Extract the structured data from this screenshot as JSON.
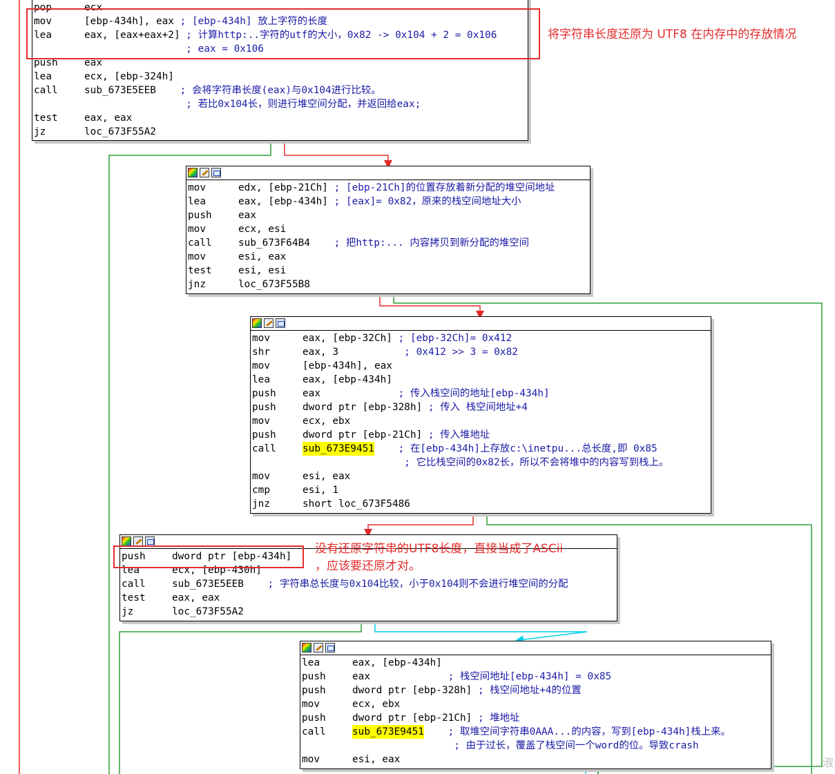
{
  "blocks": [
    {
      "has_header": false,
      "lines": [
        {
          "mn": "pop",
          "op": "ecx",
          "cm": ""
        },
        {
          "mn": "mov",
          "op": "[ebp-434h], eax",
          "cm": " ; [ebp-434h] 放上字符的长度"
        },
        {
          "mn": "lea",
          "op": "eax, [eax+eax+2]",
          "cm": " ; 计算http:..字符的utf的大小，0x82 -> 0x104 + 2 = 0x106"
        },
        {
          "mn": "",
          "op": "",
          "cm": "                 ; eax = 0x106"
        },
        {
          "mn": "push",
          "op": "eax",
          "cm": ""
        },
        {
          "mn": "lea",
          "op": "ecx, [ebp-324h]",
          "cm": ""
        },
        {
          "mn": "call",
          "op": "sub_673E5EEB",
          "cm": "    ; 会将字符串长度(eax)与0x104进行比较。"
        },
        {
          "mn": "",
          "op": "",
          "cm": "                 ; 若比0x104长，则进行堆空间分配，并返回给eax;"
        },
        {
          "mn": "test",
          "op": "eax, eax",
          "cm": ""
        },
        {
          "mn": "jz",
          "op": "loc_673F55A2",
          "cm": ""
        }
      ]
    },
    {
      "has_header": true,
      "lines": [
        {
          "mn": "mov",
          "op": "edx, [ebp-21Ch]",
          "cm": " ; [ebp-21Ch]的位置存放着新分配的堆空间地址"
        },
        {
          "mn": "lea",
          "op": "eax, [ebp-434h]",
          "cm": " ; [eax]= 0x82，原来的栈空间地址大小"
        },
        {
          "mn": "push",
          "op": "eax",
          "cm": ""
        },
        {
          "mn": "mov",
          "op": "ecx, esi",
          "cm": ""
        },
        {
          "mn": "call",
          "op": "sub_673F64B4",
          "cm": "    ; 把http:... 内容拷贝到新分配的堆空间"
        },
        {
          "mn": "mov",
          "op": "esi, eax",
          "cm": ""
        },
        {
          "mn": "test",
          "op": "esi, esi",
          "cm": ""
        },
        {
          "mn": "jnz",
          "op": "loc_673F55B8",
          "cm": ""
        }
      ]
    },
    {
      "has_header": true,
      "lines": [
        {
          "mn": "mov",
          "op": "eax, [ebp-32Ch]",
          "cm": " ; [ebp-32Ch]= 0x412"
        },
        {
          "mn": "shr",
          "op": "eax, 3",
          "cm": "           ; 0x412 >> 3 = 0x82"
        },
        {
          "mn": "mov",
          "op": "[ebp-434h], eax",
          "cm": ""
        },
        {
          "mn": "lea",
          "op": "eax, [ebp-434h]",
          "cm": ""
        },
        {
          "mn": "push",
          "op": "eax",
          "cm": "             ; 传入栈空间的地址[ebp-434h]"
        },
        {
          "mn": "push",
          "op": "dword ptr [ebp-328h]",
          "cm": " ; 传入 栈空间地址+4"
        },
        {
          "mn": "mov",
          "op": "ecx, ebx",
          "cm": ""
        },
        {
          "mn": "push",
          "op": "dword ptr [ebp-21Ch]",
          "cm": " ; 传入堆地址"
        },
        {
          "mn": "call",
          "op": "sub_673E9451",
          "cm": "    ; 在[ebp-434h]上存放c:\\inetpu...总长度,即 0x85",
          "hl": true
        },
        {
          "mn": "",
          "op": "",
          "cm": "                 ; 它比栈空间的0x82长，所以不会将堆中的内容写到栈上。"
        },
        {
          "mn": "mov",
          "op": "esi, eax",
          "cm": ""
        },
        {
          "mn": "cmp",
          "op": "esi, 1",
          "cm": ""
        },
        {
          "mn": "jnz",
          "op": "short loc_673F5486",
          "cm": ""
        }
      ]
    },
    {
      "has_header": true,
      "lines": [
        {
          "mn": "push",
          "op": "dword ptr [ebp-434h]",
          "cm": ""
        },
        {
          "mn": "lea",
          "op": "ecx, [ebp-430h]",
          "cm": ""
        },
        {
          "mn": "call",
          "op": "sub_673E5EEB",
          "cm": "    ; 字符串总长度与0x104比较，小于0x104则不会进行堆空间的分配"
        },
        {
          "mn": "test",
          "op": "eax, eax",
          "cm": ""
        },
        {
          "mn": "jz",
          "op": "loc_673F55A2",
          "cm": ""
        }
      ]
    },
    {
      "has_header": true,
      "lines": [
        {
          "mn": "lea",
          "op": "eax, [ebp-434h]",
          "cm": ""
        },
        {
          "mn": "push",
          "op": "eax",
          "cm": "             ; 栈空间地址[ebp-434h] = 0x85"
        },
        {
          "mn": "push",
          "op": "dword ptr [ebp-328h]",
          "cm": " ; 栈空间地址+4的位置"
        },
        {
          "mn": "mov",
          "op": "ecx, ebx",
          "cm": ""
        },
        {
          "mn": "push",
          "op": "dword ptr [ebp-21Ch]",
          "cm": " ; 堆地址"
        },
        {
          "mn": "call",
          "op": "sub_673E9451",
          "cm": "    ; 取堆空间字符串0AAA...的内容，写到[ebp-434h]栈上来。",
          "hl": true
        },
        {
          "mn": "",
          "op": "",
          "cm": "                 ; 由于过长，覆盖了栈空间一个word的位。导致crash"
        },
        {
          "mn": "mov",
          "op": "esi, eax",
          "cm": ""
        }
      ]
    }
  ],
  "notes": {
    "note1": "将字符串长度还原为 UTF8 在内存中的存放情况",
    "note2_line1": "没有还原字符串的UTF8长度，直接当成了ASCii",
    "note2_line2": "，应该要还原才对。"
  },
  "colors": {
    "true_edge": "#2e9e3a",
    "false_edge": "#e32b2b",
    "uncond_edge": "#00cfe8",
    "comment": "#1a1aa6",
    "highlight": "#ffff00",
    "annotation": "#e32b2b"
  }
}
